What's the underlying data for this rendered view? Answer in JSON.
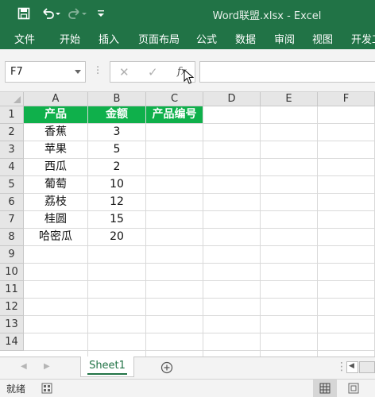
{
  "window": {
    "title": "Word联盟.xlsx - Excel"
  },
  "quick_access": {
    "save_icon": "save-icon",
    "undo_icon": "undo-icon",
    "redo_icon": "redo-icon",
    "customize_icon": "customize-qat-icon"
  },
  "ribbon": {
    "tabs": [
      "文件",
      "开始",
      "插入",
      "页面布局",
      "公式",
      "数据",
      "审阅",
      "视图",
      "开发工"
    ]
  },
  "formula_bar": {
    "name_box": "F7",
    "cancel_icon": "✕",
    "enter_icon": "✓",
    "fx_label": "fx",
    "formula_value": ""
  },
  "columns": [
    "A",
    "B",
    "C",
    "D",
    "E",
    "F"
  ],
  "rows": [
    "1",
    "2",
    "3",
    "4",
    "5",
    "6",
    "7",
    "8",
    "9",
    "10",
    "11",
    "12",
    "13",
    "14"
  ],
  "table": {
    "headers": [
      "产品",
      "金额",
      "产品编号"
    ],
    "rows": [
      [
        "香蕉",
        "3",
        ""
      ],
      [
        "苹果",
        "5",
        ""
      ],
      [
        "西瓜",
        "2",
        ""
      ],
      [
        "葡萄",
        "10",
        ""
      ],
      [
        "荔枝",
        "12",
        ""
      ],
      [
        "桂圆",
        "15",
        ""
      ],
      [
        "哈密瓜",
        "20",
        ""
      ]
    ]
  },
  "sheet_tabs": {
    "active": "Sheet1"
  },
  "status_bar": {
    "ready": "就绪"
  },
  "colors": {
    "accent": "#217346",
    "header_fill": "#0fb04b"
  }
}
